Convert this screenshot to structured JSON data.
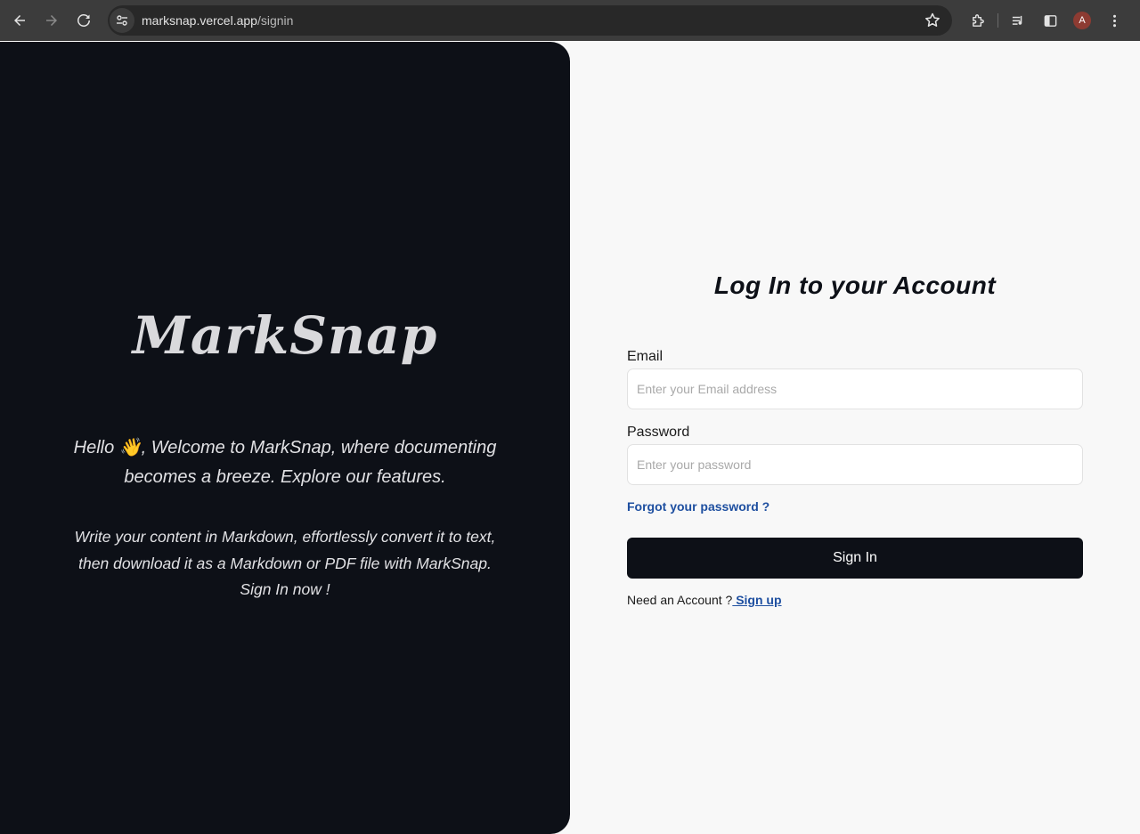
{
  "browser": {
    "url_host": "marksnap.vercel.app",
    "url_path": "/signin",
    "profile_initial": "A",
    "icons": [
      "back-icon",
      "forward-icon",
      "reload-icon",
      "site-info-icon",
      "bookmark-star-icon",
      "extensions-icon",
      "media-controls-icon",
      "side-panel-icon",
      "more-menu-icon"
    ]
  },
  "left": {
    "brand": "MarkSnap",
    "welcome_line1": "Hello 👋, Welcome to MarkSnap, where documenting",
    "welcome_line2": "becomes a breeze. Explore our features.",
    "desc_line1": "Write your content in Markdown, effortlessly convert it to text,",
    "desc_line2": "then download it as a Markdown or PDF file with MarkSnap.",
    "desc_line3": "Sign In now !"
  },
  "form": {
    "title": "Log In to your Account",
    "email_label": "Email",
    "email_placeholder": "Enter your Email address",
    "password_label": "Password",
    "password_placeholder": "Enter your password",
    "forgot": "Forgot your password ?",
    "signin_label": "Sign In",
    "need_account": "Need an Account ?",
    "signup": " Sign up"
  },
  "colors": {
    "dark": "#0d1017",
    "link": "#1e4fa0",
    "page_bg": "#f8f8f8"
  }
}
